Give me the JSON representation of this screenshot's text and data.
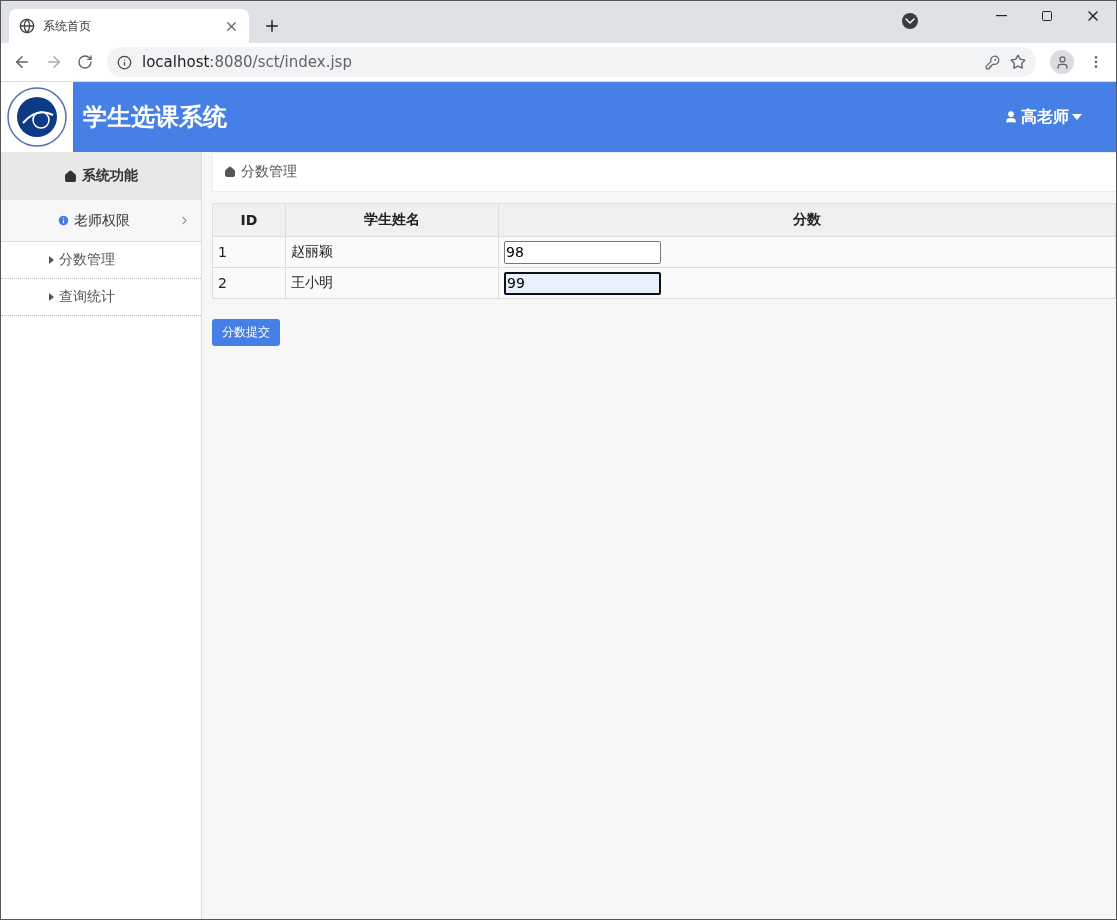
{
  "browser": {
    "tab_title": "系统首页",
    "url_host": "localhost",
    "url_path": ":8080/sct/index.jsp"
  },
  "header": {
    "title": "学生选课系统",
    "user": "高老师"
  },
  "sidebar": {
    "heading": "系统功能",
    "group": {
      "label": "老师权限",
      "expanded": true,
      "children": [
        {
          "label": "分数管理"
        },
        {
          "label": "查询统计"
        }
      ]
    }
  },
  "breadcrumb": "分数管理",
  "table": {
    "columns": [
      "ID",
      "学生姓名",
      "分数"
    ],
    "rows": [
      {
        "id": "1",
        "name": "赵丽颖",
        "score": "98",
        "focused": false
      },
      {
        "id": "2",
        "name": "王小明",
        "score": "99",
        "focused": true
      }
    ]
  },
  "submit_button": "分数提交"
}
